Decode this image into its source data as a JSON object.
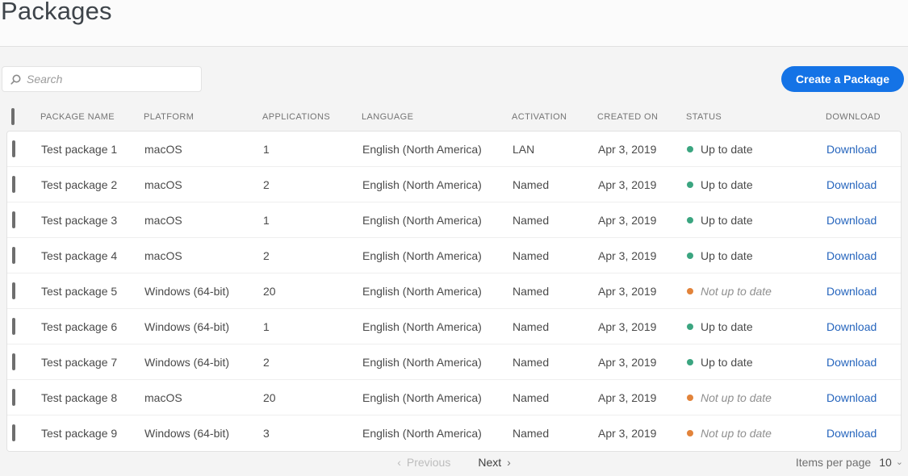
{
  "page": {
    "title": "Packages"
  },
  "toolbar": {
    "search_placeholder": "Search",
    "create_button_label": "Create a Package"
  },
  "table": {
    "columns": {
      "name": "PACKAGE NAME",
      "platform": "PLATFORM",
      "applications": "APPLICATIONS",
      "language": "LANGUAGE",
      "activation": "ACTIVATION",
      "created_on": "CREATED ON",
      "status": "STATUS",
      "download": "DOWNLOAD"
    },
    "download_label": "Download",
    "rows": [
      {
        "name": "Test package 1",
        "platform": "macOS",
        "applications": "1",
        "language": "English (North America)",
        "activation": "LAN",
        "created_on": "Apr 3, 2019",
        "status": "Up to date",
        "status_state": "up-to-date"
      },
      {
        "name": "Test package 2",
        "platform": "macOS",
        "applications": "2",
        "language": "English (North America)",
        "activation": "Named",
        "created_on": "Apr 3, 2019",
        "status": "Up to date",
        "status_state": "up-to-date"
      },
      {
        "name": "Test package 3",
        "platform": "macOS",
        "applications": "1",
        "language": "English (North America)",
        "activation": "Named",
        "created_on": "Apr 3, 2019",
        "status": "Up to date",
        "status_state": "up-to-date"
      },
      {
        "name": "Test package 4",
        "platform": "macOS",
        "applications": "2",
        "language": "English (North America)",
        "activation": "Named",
        "created_on": "Apr 3, 2019",
        "status": "Up to date",
        "status_state": "up-to-date"
      },
      {
        "name": "Test package 5",
        "platform": "Windows (64-bit)",
        "applications": "20",
        "language": "English (North America)",
        "activation": "Named",
        "created_on": "Apr 3, 2019",
        "status": "Not up to date",
        "status_state": "not-up-to-date"
      },
      {
        "name": "Test package 6",
        "platform": "Windows (64-bit)",
        "applications": "1",
        "language": "English (North America)",
        "activation": "Named",
        "created_on": "Apr 3, 2019",
        "status": "Up to date",
        "status_state": "up-to-date"
      },
      {
        "name": "Test package 7",
        "platform": "Windows (64-bit)",
        "applications": "2",
        "language": "English (North America)",
        "activation": "Named",
        "created_on": "Apr 3, 2019",
        "status": "Up to date",
        "status_state": "up-to-date"
      },
      {
        "name": "Test package 8",
        "platform": "macOS",
        "applications": "20",
        "language": "English (North America)",
        "activation": "Named",
        "created_on": "Apr 3, 2019",
        "status": "Not up to date",
        "status_state": "not-up-to-date"
      },
      {
        "name": "Test package 9",
        "platform": "Windows (64-bit)",
        "applications": "3",
        "language": "English (North America)",
        "activation": "Named",
        "created_on": "Apr 3, 2019",
        "status": "Not up to date",
        "status_state": "not-up-to-date"
      }
    ]
  },
  "pagination": {
    "previous_label": "Previous",
    "next_label": "Next",
    "prev_chevron": "‹",
    "next_chevron": "›",
    "items_per_page_label": "Items per page",
    "items_per_page_value": "10",
    "dropdown_chevron": "⌄"
  },
  "colors": {
    "accent_blue": "#1473e6",
    "link_blue": "#2665bd",
    "status_green": "#3ba580",
    "status_orange": "#e2833a",
    "panel_gray": "#f4f4f4"
  }
}
